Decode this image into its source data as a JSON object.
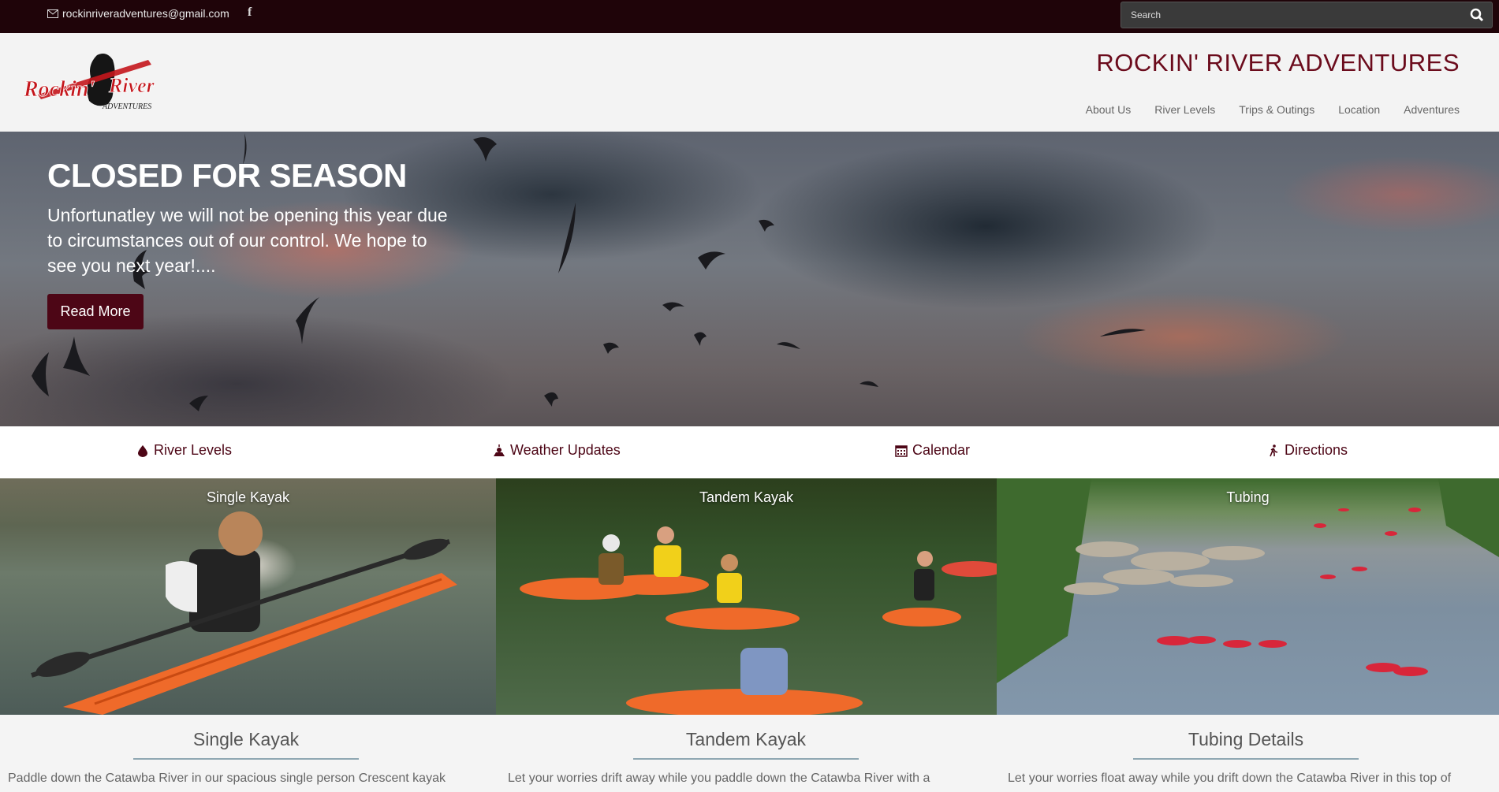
{
  "topbar": {
    "email": "rockinriveradventures@gmail.com",
    "facebook_icon": "facebook-icon",
    "search_placeholder": "Search"
  },
  "header": {
    "logo_text_1": "Rockin'",
    "logo_text_2": "River",
    "logo_text_3": "ADVENTURES",
    "site_title": "ROCKIN' RIVER ADVENTURES",
    "nav": [
      "About Us",
      "River Levels",
      "Trips & Outings",
      "Location",
      "Adventures"
    ]
  },
  "hero": {
    "title": "CLOSED FOR SEASON",
    "text": "Unfortunatley we will not be opening this year due to circumstances out of our control. We hope to see you next year!....",
    "button": "Read More"
  },
  "quick_links": [
    {
      "label": "River Levels",
      "icon": "drop-icon"
    },
    {
      "label": "Weather Updates",
      "icon": "weather-icon"
    },
    {
      "label": "Calendar",
      "icon": "calendar-icon"
    },
    {
      "label": "Directions",
      "icon": "walking-icon"
    }
  ],
  "cards": [
    {
      "caption": "Single Kayak",
      "title": "Single Kayak",
      "desc": "Paddle down the Catawba River in our spacious single person Crescent kayak"
    },
    {
      "caption": "Tandem Kayak",
      "title": "Tandem Kayak",
      "desc": "Let your worries drift away while you paddle down the Catawba River with a"
    },
    {
      "caption": "Tubing",
      "title": "Tubing Details",
      "desc": "Let your worries float away while you drift down the Catawba River in this top of"
    }
  ],
  "colors": {
    "brand": "#4d0616",
    "topbar": "#1f0409",
    "title": "#6b0b1c"
  }
}
